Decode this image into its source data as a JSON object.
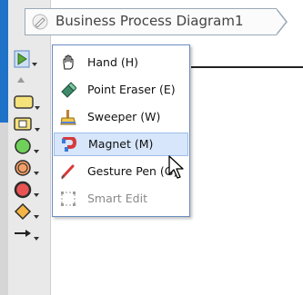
{
  "breadcrumb": {
    "label": "Business Process Diagram1",
    "icon": "diagram-pencil-icon"
  },
  "menu": {
    "items": [
      {
        "label": "Hand (H)",
        "icon": "hand-icon",
        "enabled": true,
        "hovered": false
      },
      {
        "label": "Point Eraser (E)",
        "icon": "point-eraser-icon",
        "enabled": true,
        "hovered": false
      },
      {
        "label": "Sweeper (W)",
        "icon": "sweeper-icon",
        "enabled": true,
        "hovered": false
      },
      {
        "label": "Magnet (M)",
        "icon": "magnet-icon",
        "enabled": true,
        "hovered": true
      },
      {
        "label": "Gesture Pen (G)",
        "icon": "gesture-pen-icon",
        "enabled": true,
        "hovered": false
      },
      {
        "label": "Smart Edit",
        "icon": "smart-edit-icon",
        "enabled": false,
        "hovered": false
      }
    ]
  },
  "toolbar": {
    "tools": [
      "selector-icon",
      "collapse-arrow-icon",
      "lane-icon",
      "task-icon",
      "start-event-icon",
      "intermediate-event-icon",
      "end-event-icon",
      "gateway-icon",
      "sequence-flow-icon"
    ]
  },
  "colors": {
    "accent": "#1e73c8",
    "menu_border": "#6a8dc0",
    "hover": "#d7e6fa"
  }
}
